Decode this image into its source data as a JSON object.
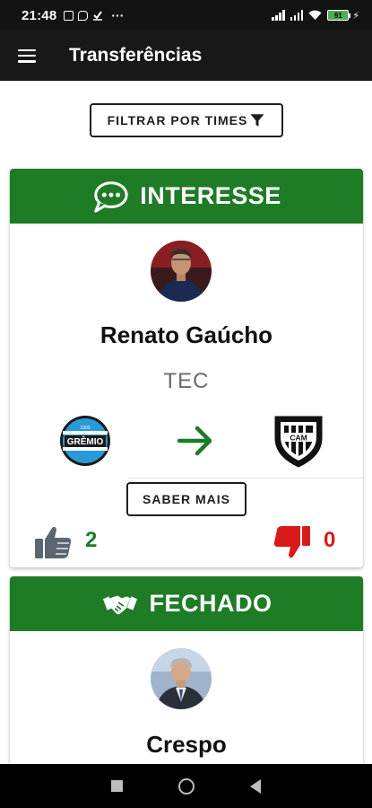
{
  "status_bar": {
    "time": "21:48",
    "battery": "91",
    "left_icons": [
      "instagram-icon",
      "message-icon",
      "download-check-icon"
    ],
    "overflow": "···"
  },
  "app_bar": {
    "title": "Transferências",
    "menu_icon": "hamburger-menu-icon"
  },
  "filter": {
    "label": "FILTRAR POR TIMES",
    "icon": "filter-funnel-icon"
  },
  "transfers": [
    {
      "status": "INTERESSE",
      "status_icon": "chat-bubble-icon",
      "name": "Renato Gaúcho",
      "role": "TEC",
      "from_club": "GRÊMIO",
      "from_club_year": "1903",
      "to_club": "CAM",
      "more_label": "SABER MAIS",
      "likes": "2",
      "dislikes": "0"
    },
    {
      "status": "FECHADO",
      "status_icon": "handshake-icon",
      "name": "Crespo"
    }
  ],
  "colors": {
    "header_green": "#1e7b26",
    "app_bar": "#181818",
    "like_gray": "#5c6672",
    "dislike_red": "#d81a1a"
  },
  "nav_bar": {
    "buttons": [
      "recents-square-icon",
      "home-circle-icon",
      "back-triangle-icon"
    ]
  }
}
